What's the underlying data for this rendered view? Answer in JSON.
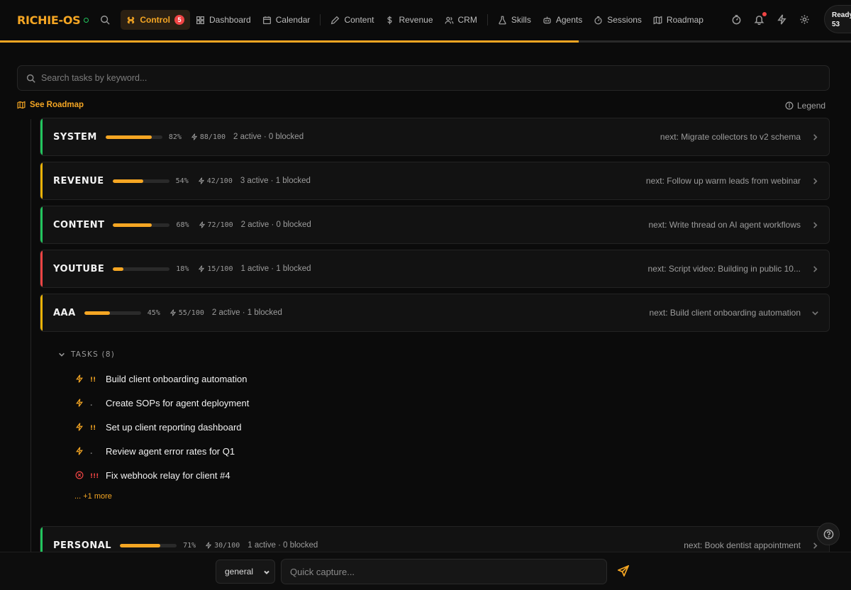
{
  "app": {
    "logo": "RICHIE-OS",
    "ready_label": "Ready",
    "ready_count": "53"
  },
  "nav": [
    {
      "id": "control",
      "label": "Control",
      "icon": "command-icon",
      "badge": "5",
      "active": true
    },
    {
      "id": "dashboard",
      "label": "Dashboard",
      "icon": "grid-icon"
    },
    {
      "id": "calendar",
      "label": "Calendar",
      "icon": "calendar-icon"
    },
    {
      "id": "content",
      "label": "Content",
      "icon": "pen-icon"
    },
    {
      "id": "revenue",
      "label": "Revenue",
      "icon": "dollar-icon"
    },
    {
      "id": "crm",
      "label": "CRM",
      "icon": "users-icon"
    },
    {
      "id": "skills",
      "label": "Skills",
      "icon": "flask-icon"
    },
    {
      "id": "agents",
      "label": "Agents",
      "icon": "bot-icon"
    },
    {
      "id": "sessions",
      "label": "Sessions",
      "icon": "timer-icon"
    },
    {
      "id": "roadmap",
      "label": "Roadmap",
      "icon": "map-icon"
    }
  ],
  "top_progress": 0.68,
  "search": {
    "placeholder": "Search tasks by keyword..."
  },
  "links": {
    "roadmap": "See Roadmap",
    "legend": "Legend"
  },
  "colors": {
    "accent": "#f5a623",
    "healthy": "#22c55e",
    "warning": "#eab308",
    "danger": "#ef4444"
  },
  "areas": [
    {
      "name": "SYSTEM",
      "status": "healthy",
      "progress": 82,
      "pct": "82%",
      "score": "88/100",
      "counts": "2 active · 0 blocked",
      "next": "next: Migrate collectors to v2 schema",
      "expanded": false
    },
    {
      "name": "REVENUE",
      "status": "warning",
      "progress": 54,
      "pct": "54%",
      "score": "42/100",
      "counts": "3 active · 1 blocked",
      "next": "next: Follow up warm leads from webinar",
      "expanded": false
    },
    {
      "name": "CONTENT",
      "status": "healthy",
      "progress": 68,
      "pct": "68%",
      "score": "72/100",
      "counts": "2 active · 0 blocked",
      "next": "next: Write thread on AI agent workflows",
      "expanded": false
    },
    {
      "name": "YOUTUBE",
      "status": "danger",
      "progress": 18,
      "pct": "18%",
      "score": "15/100",
      "counts": "1 active · 1 blocked",
      "next": "next: Script video: Building in public 10...",
      "expanded": false
    },
    {
      "name": "AAA",
      "status": "warning",
      "progress": 45,
      "pct": "45%",
      "score": "55/100",
      "counts": "2 active · 1 blocked",
      "next": "next: Build client onboarding automation",
      "expanded": true,
      "tasks_label": "TASKS (8)",
      "tasks": [
        {
          "title": "Build client onboarding automation",
          "icon": "bolt-icon",
          "priority": "!!",
          "priority_color": "#f5a623"
        },
        {
          "title": "Create SOPs for agent deployment",
          "icon": "bolt-icon",
          "priority": ".",
          "priority_color": "#7a7a7a"
        },
        {
          "title": "Set up client reporting dashboard",
          "icon": "bolt-icon",
          "priority": "!!",
          "priority_color": "#f5a623"
        },
        {
          "title": "Review agent error rates for Q1",
          "icon": "bolt-icon",
          "priority": ".",
          "priority_color": "#7a7a7a"
        },
        {
          "title": "Fix webhook relay for client #4",
          "icon": "blocked-icon",
          "priority": "!!!",
          "priority_color": "#ef4444"
        }
      ],
      "more": "... +1 more"
    },
    {
      "name": "PERSONAL",
      "status": "healthy",
      "progress": 71,
      "pct": "71%",
      "score": "30/100",
      "counts": "1 active · 0 blocked",
      "next": "next: Book dentist appointment",
      "expanded": false
    }
  ],
  "capture": {
    "category": "general",
    "placeholder": "Quick capture..."
  }
}
